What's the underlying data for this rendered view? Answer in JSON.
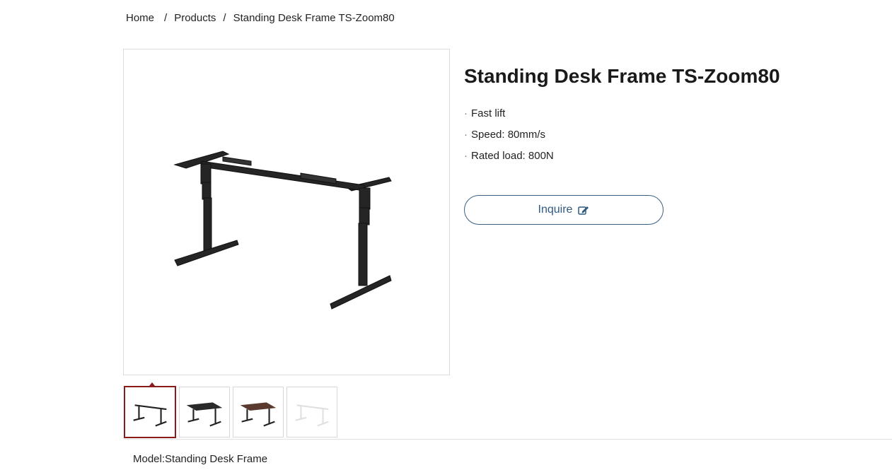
{
  "breadcrumb": {
    "home": "Home",
    "separator": "/",
    "products": "Products",
    "current": "Standing Desk Frame TS-Zoom80"
  },
  "product": {
    "title": "Standing Desk Frame TS-Zoom80",
    "bullet": "·",
    "features": [
      "Fast lift",
      "Speed: 80mm/s",
      "Rated load: 800N"
    ],
    "inquire_label": "Inquire",
    "model_text": "Model:Standing Desk Frame"
  },
  "gallery": {
    "selected_index": 0,
    "thumbnails": [
      {
        "variant": "frame-black",
        "top_color": "none",
        "leg_color": "#222222"
      },
      {
        "variant": "black-top",
        "top_color": "#2a2a2a",
        "leg_color": "#222222"
      },
      {
        "variant": "walnut-top",
        "top_color": "#5a3a2e",
        "leg_color": "#222222"
      },
      {
        "variant": "white-frame",
        "top_color": "none",
        "leg_color": "#e6e6e6"
      }
    ]
  },
  "colors": {
    "accent": "#2f5a80",
    "active_thumb_border": "#8b1a1a",
    "frame": "#252525"
  },
  "icons": {
    "inquire": "edit-icon"
  }
}
